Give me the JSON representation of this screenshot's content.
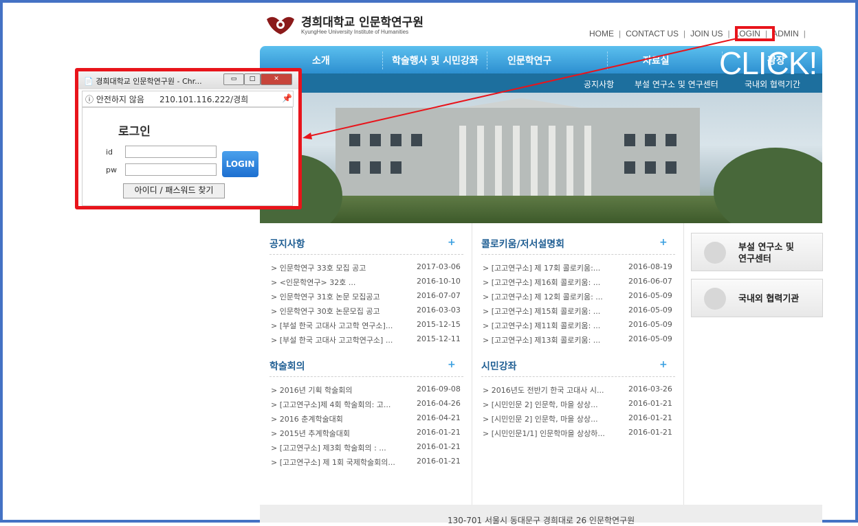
{
  "site": {
    "title": "경희대학교 인문학연구원",
    "subtitle": "KyungHee University Institute of Humanities"
  },
  "topnav": {
    "items": [
      "HOME",
      "CONTACT US",
      "JOIN US",
      "LOGIN",
      "ADMIN"
    ],
    "separator": "|"
  },
  "mainnav": {
    "items": [
      "소개",
      "학술행사 및 시민강좌",
      "인문학연구",
      "자료실",
      "광장"
    ]
  },
  "subnav": {
    "items": [
      "공지사항",
      "부설 연구소 및 연구센터",
      "국내외 협력기간"
    ]
  },
  "callout": {
    "text": "CLICK!",
    "color": "#e8141b"
  },
  "popup": {
    "title": "경희대학교 인문학연구원 - Chr...",
    "security_label": "ⓘ 안전하지 않음",
    "address": "210.101.116.222/경희",
    "heading": "로그인",
    "id_label": "id",
    "pw_label": "pw",
    "login_button": "LOGIN",
    "find_button": "아이디 / 패스워드 찾기",
    "minimize": "▭",
    "maximize": "□",
    "close": "✕"
  },
  "sections": {
    "notice": {
      "title": "공지사항",
      "plus": "+",
      "rows": [
        {
          "text": "> 인문학연구 33호 모집 공고",
          "date": "2017-03-06"
        },
        {
          "text": "> <인문학연구> 32호 ...",
          "date": "2016-10-10"
        },
        {
          "text": "> 인문학연구 31호 논문 모집공고",
          "date": "2016-07-07"
        },
        {
          "text": "> 인문학연구 30호 논문모집 공고",
          "date": "2016-03-03"
        },
        {
          "text": "> [부설 한국 고대사 고고학 연구소]...",
          "date": "2015-12-15"
        },
        {
          "text": "> [부설 한국 고대사 고고학연구소] ...",
          "date": "2015-12-11"
        }
      ]
    },
    "colloquium": {
      "title": "콜로키움/저서설명회",
      "plus": "+",
      "rows": [
        {
          "text": "> [고고연구소] 제 17회 콜로키움:...",
          "date": "2016-08-19"
        },
        {
          "text": "> [고고연구소] 제16회 콜로키움: ...",
          "date": "2016-06-07"
        },
        {
          "text": "> [고고연구소] 제 12회 콜로키움: ...",
          "date": "2016-05-09"
        },
        {
          "text": "> [고고연구소] 제15회 콜로키움: ...",
          "date": "2016-05-09"
        },
        {
          "text": "> [고고연구소] 제11회 콜로키움: ...",
          "date": "2016-05-09"
        },
        {
          "text": "> [고고연구소] 제13회 콜로키움: ...",
          "date": "2016-05-09"
        }
      ]
    },
    "conference": {
      "title": "학술회의",
      "plus": "+",
      "rows": [
        {
          "text": "> 2016년 기획 학술회의",
          "date": "2016-09-08"
        },
        {
          "text": "> [고고연구소]제 4회 학술회의: 고...",
          "date": "2016-04-26"
        },
        {
          "text": "> 2016 춘계학술대회",
          "date": "2016-04-21"
        },
        {
          "text": "> 2015년 추계학술대회",
          "date": "2016-01-21"
        },
        {
          "text": "> [고고연구소] 제3회 학술회의 : ...",
          "date": "2016-01-21"
        },
        {
          "text": "> [고고연구소] 제 1회 국제학술회의...",
          "date": "2016-01-21"
        }
      ]
    },
    "lecture": {
      "title": "시민강좌",
      "plus": "+",
      "rows": [
        {
          "text": "> 2016년도 전반기 한국 고대사 시...",
          "date": "2016-03-26"
        },
        {
          "text": "> [시민인문 2] 인문학, 마을 상상...",
          "date": "2016-01-21"
        },
        {
          "text": "> [시민인문 2] 인문학, 마을 상상...",
          "date": "2016-01-21"
        },
        {
          "text": "> [시민인문1/1] 인문학마을 상상하...",
          "date": "2016-01-21"
        }
      ]
    }
  },
  "side": {
    "institutes": "부설 연구소 및\n연구센터",
    "institutes_line1": "부설 연구소 및",
    "institutes_line2": "연구센터",
    "partners": "국내외 협력기관"
  },
  "footer": {
    "text": "130-701 서울시 동대문구 경희대로 26 인문학연구원"
  }
}
